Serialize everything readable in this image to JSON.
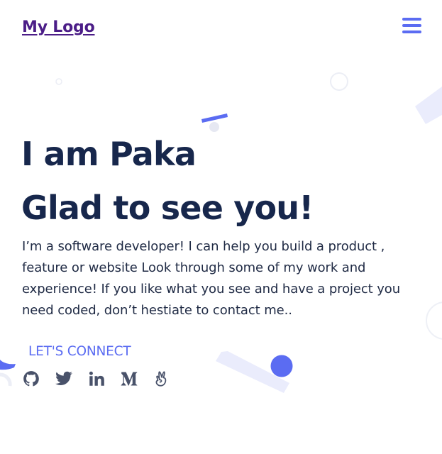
{
  "header": {
    "logo_text": "My Logo",
    "menu_icon": "hamburger-menu-icon"
  },
  "hero": {
    "title": "I am Paka",
    "subtitle": "Glad to see you!",
    "description": "I’m a software developer! I can help you build a product , feature or website Look through some of my work and experience! If you like what you see and have a project you need coded, don’t hestiate to contact me.."
  },
  "connect": {
    "label": "LET'S CONNECT",
    "socials": [
      {
        "icon": "github-icon"
      },
      {
        "icon": "twitter-icon"
      },
      {
        "icon": "linkedin-icon"
      },
      {
        "icon": "medium-icon"
      },
      {
        "icon": "angellist-icon"
      }
    ]
  },
  "colors": {
    "accent": "#5b6cf2",
    "logo": "#4b1d87",
    "heading": "#17274c",
    "body_text": "#1f2a44",
    "icon_gray": "#49526a",
    "decor_light": "#ebedfc"
  }
}
